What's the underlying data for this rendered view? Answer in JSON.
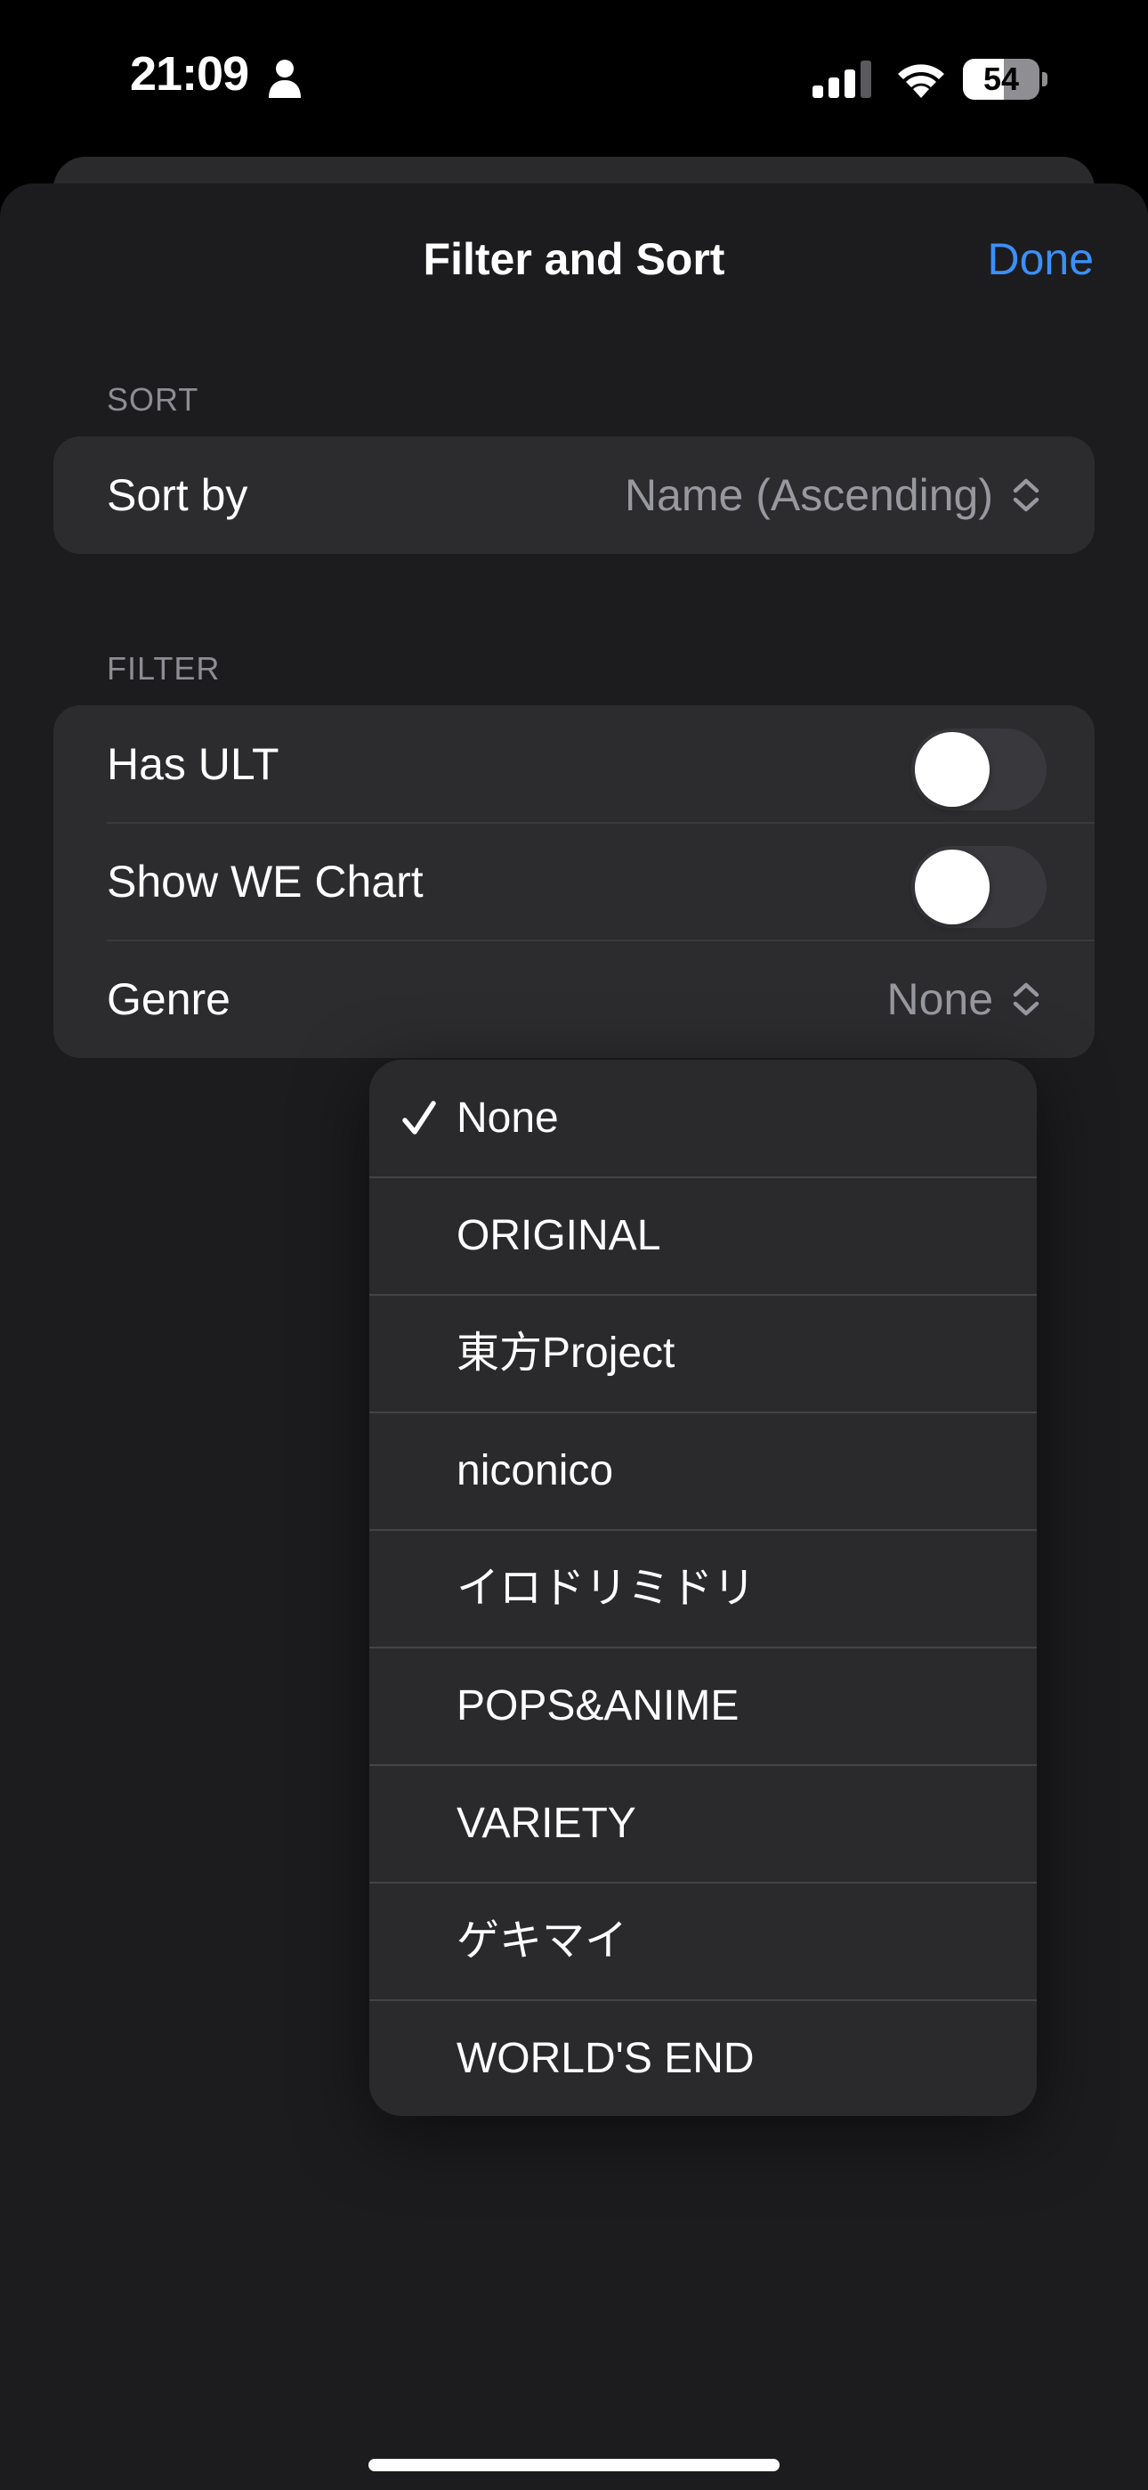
{
  "status_bar": {
    "time": "21:09",
    "battery_level": "54",
    "battery_fraction": 0.54,
    "icons": [
      "person-icon",
      "signal-icon",
      "wifi-icon",
      "battery-icon"
    ]
  },
  "nav": {
    "title": "Filter and Sort",
    "done_label": "Done"
  },
  "sort_section": {
    "header": "SORT",
    "sort_by_label": "Sort by",
    "sort_by_value": "Name (Ascending)"
  },
  "filter_section": {
    "header": "FILTER",
    "has_ult_label": "Has ULT",
    "has_ult_on": false,
    "show_we_label": "Show WE Chart",
    "show_we_on": false,
    "genre_label": "Genre",
    "genre_value": "None"
  },
  "genre_menu": {
    "selected": "None",
    "items": [
      "None",
      "ORIGINAL",
      "東方Project",
      "niconico",
      "イロドリミドリ",
      "POPS&ANIME",
      "VARIETY",
      "ゲキマイ",
      "WORLD'S END"
    ]
  },
  "colors": {
    "accent": "#3c8ff7",
    "background": "#000000",
    "sheet": "#1c1c1e",
    "group": "#2c2c2e",
    "secondary_text": "#98989f"
  }
}
